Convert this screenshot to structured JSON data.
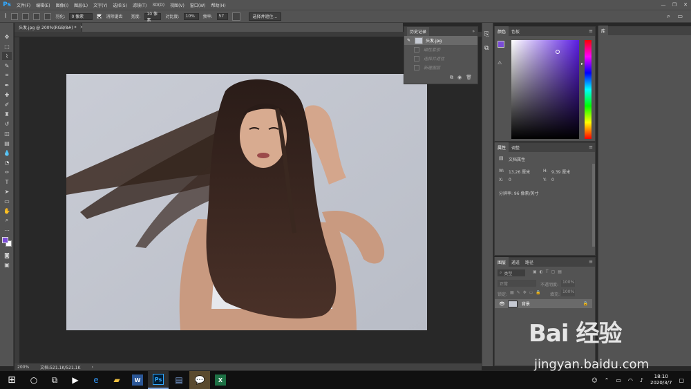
{
  "menubar": {
    "logo": "Ps",
    "items": [
      "文件(F)",
      "编辑(E)",
      "图像(I)",
      "图层(L)",
      "文字(Y)",
      "选择(S)",
      "滤镜(T)",
      "3D(D)",
      "视图(V)",
      "窗口(W)",
      "帮助(H)"
    ],
    "window_controls": [
      "—",
      "❐",
      "✕"
    ]
  },
  "options": {
    "feather_label": "羽化:",
    "feather_value": "0 像素",
    "smooth_label": "消除锯齿",
    "width_label": "宽度:",
    "width_value": "10 像素",
    "contrast_label": "对比度:",
    "contrast_value": "10%",
    "frequency_label": "频率:",
    "frequency_value": "57",
    "select_mask_button": "选择并遮住..."
  },
  "document": {
    "tab_title": "头发.jpg @ 200%(RGB/8#) *",
    "close": "×",
    "zoom": "200%",
    "doc_size": "文档:521.1K/521.1K",
    "status_arrow": "›"
  },
  "history": {
    "title": "历史记录",
    "snapshot": "头发.jpg",
    "steps": [
      "磁性套索",
      "选择并遮住",
      "新建图层"
    ]
  },
  "color_panel": {
    "tabs": [
      "颜色",
      "色板"
    ],
    "foreground": "#7a4cd6",
    "background": "#ffffff"
  },
  "library": {
    "tab": "库"
  },
  "properties": {
    "tabs": [
      "属性",
      "调整"
    ],
    "section": "文档属性",
    "w_label": "W:",
    "w_value": "13.26 厘米",
    "h_label": "H:",
    "h_value": "9.39 厘米",
    "x_label": "X:",
    "x_value": "0",
    "y_label": "Y:",
    "y_value": "0",
    "resolution": "分辨率: 96 像素/英寸"
  },
  "layers": {
    "tabs": [
      "图层",
      "通道",
      "路径"
    ],
    "kind": "类型",
    "blend_mode": "正常",
    "opacity_label": "不透明度:",
    "opacity_value": "100%",
    "lock_label": "锁定:",
    "fill_label": "填充:",
    "fill_value": "100%",
    "items": [
      {
        "name": "背景"
      }
    ]
  },
  "watermark": {
    "brand": "Bai 经验",
    "url": "jingyan.baidu.com"
  },
  "taskbar": {
    "apps": [
      "Ps",
      "W",
      "X"
    ],
    "time": "18:10",
    "date": "2020/3/7"
  }
}
